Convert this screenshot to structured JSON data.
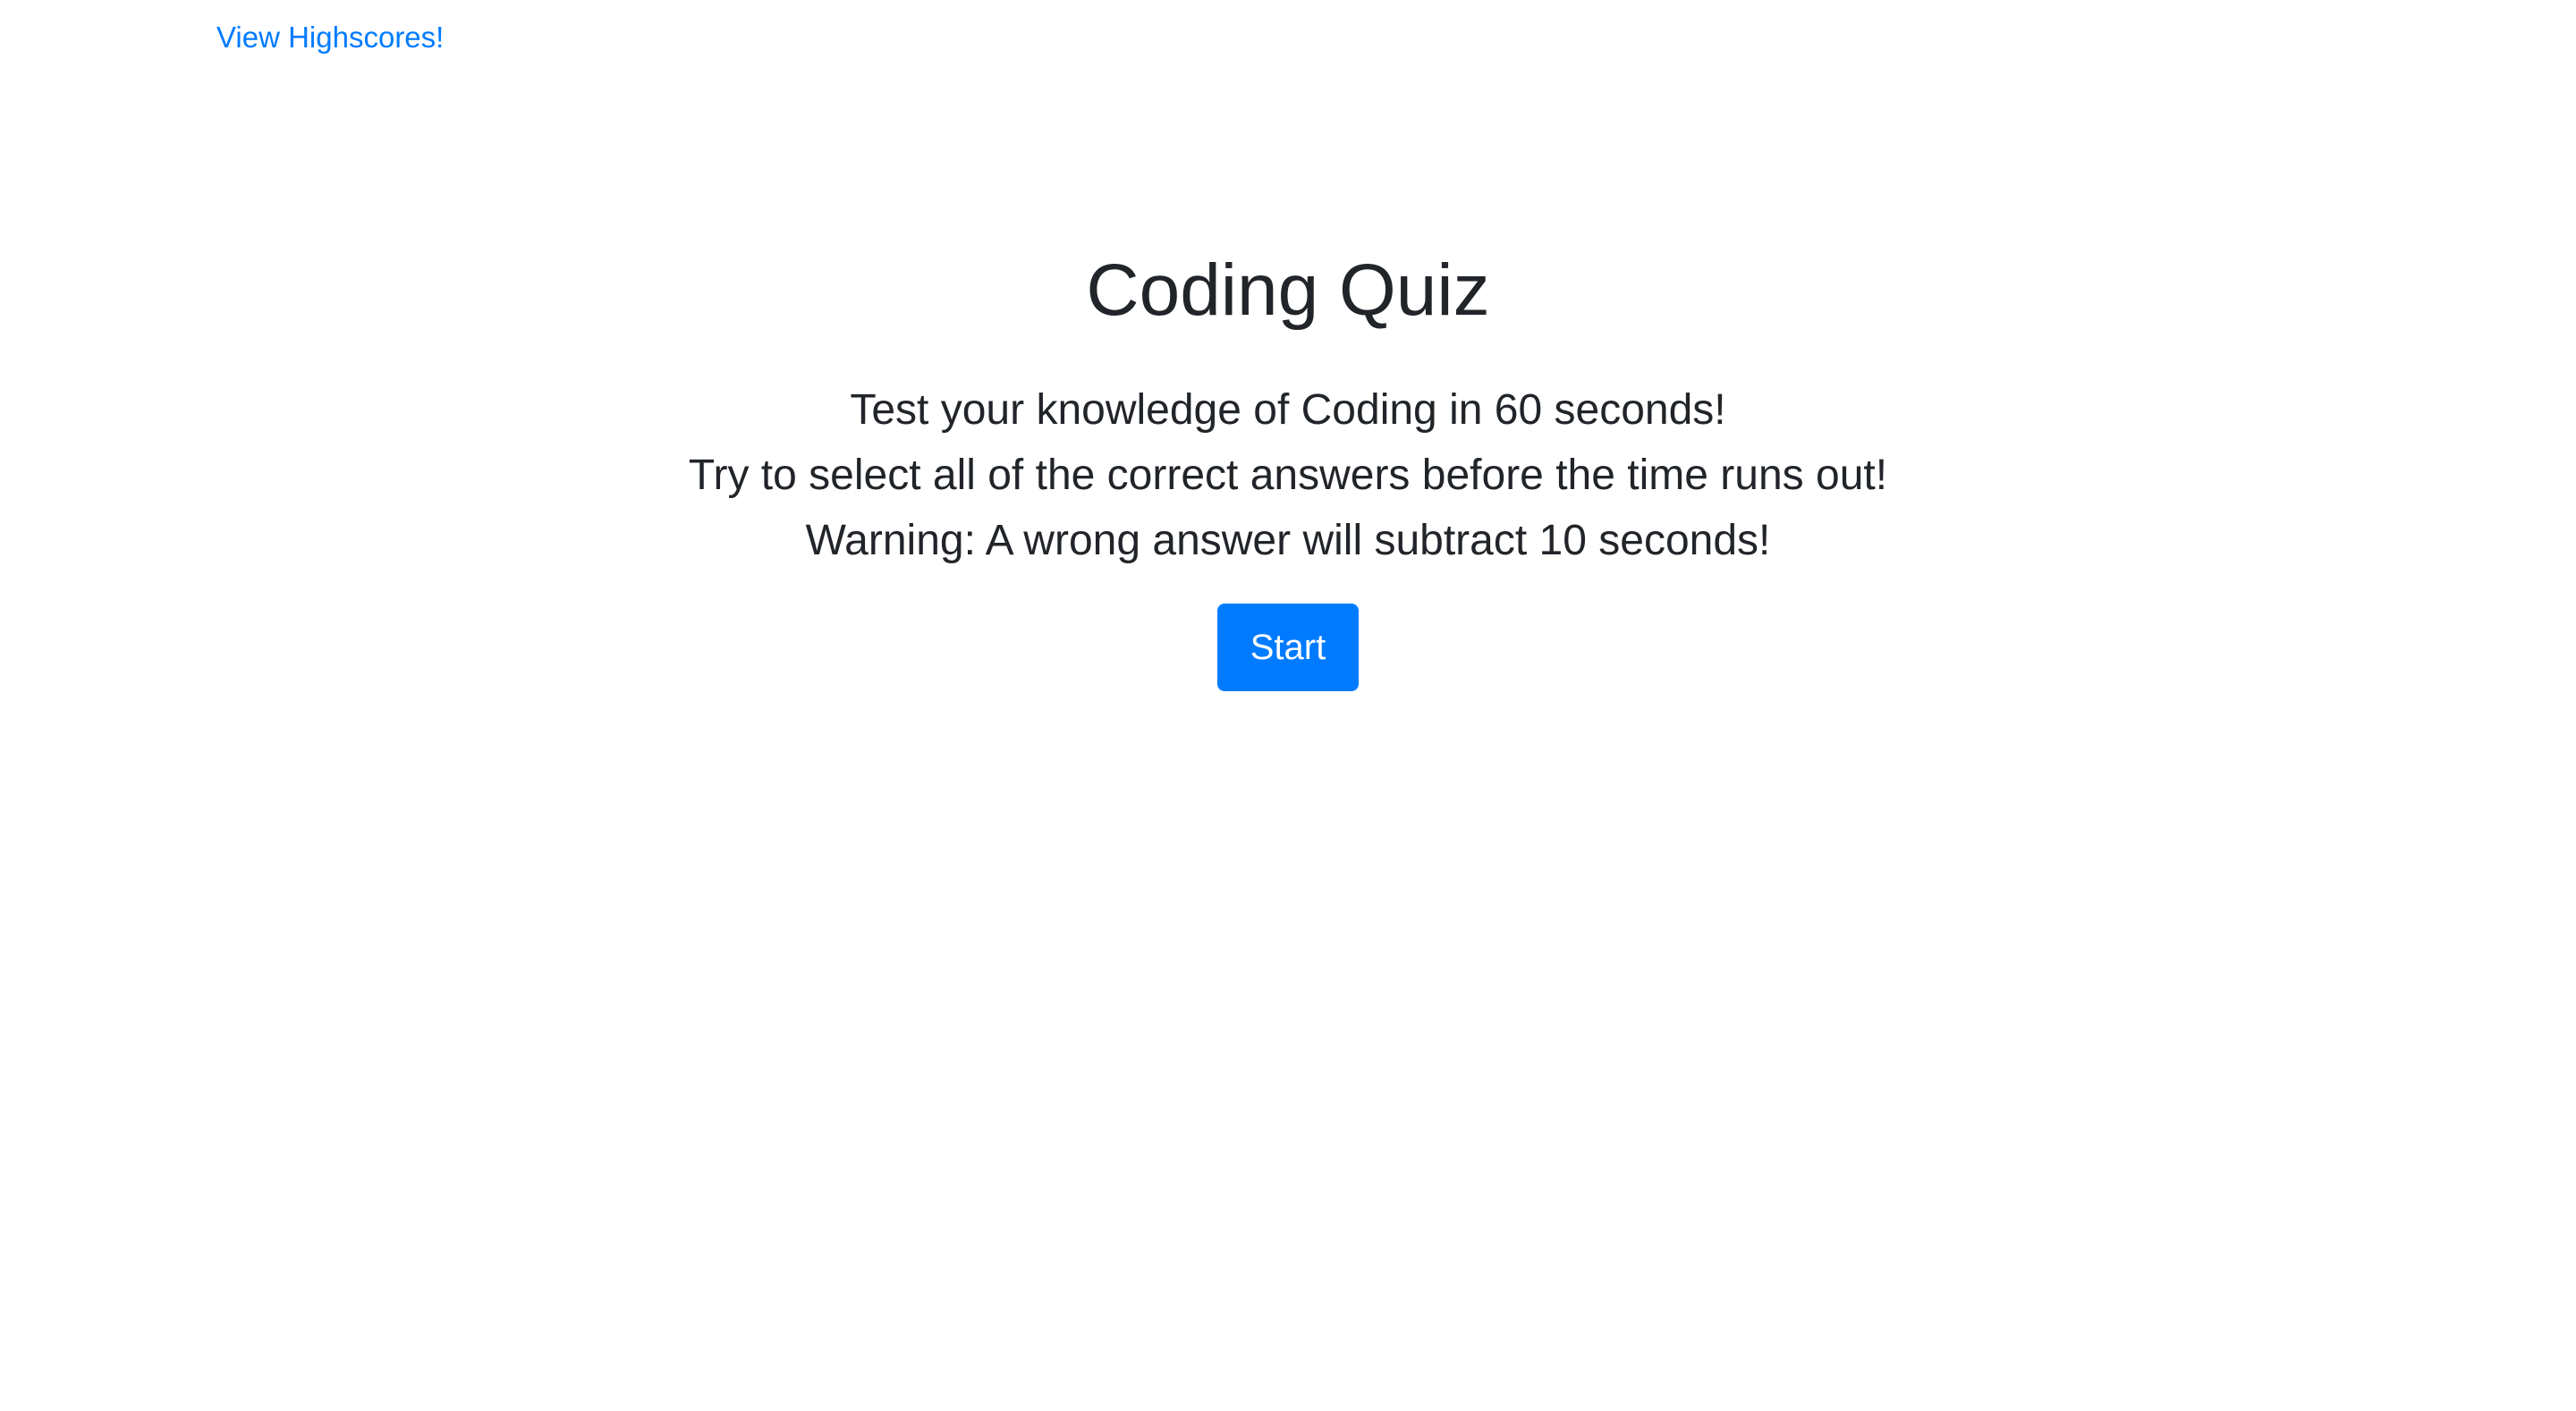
{
  "nav": {
    "highscores_label": "View Highscores!"
  },
  "main": {
    "title": "Coding Quiz",
    "intro_lines": [
      "Test your knowledge of Coding in 60 seconds!",
      "Try to select all of the correct answers before the time runs out!",
      "Warning: A wrong answer will subtract 10 seconds!"
    ],
    "start_label": "Start"
  },
  "colors": {
    "link": "#007bff",
    "primary_button": "#007bff",
    "text": "#212529",
    "background": "#ffffff"
  }
}
